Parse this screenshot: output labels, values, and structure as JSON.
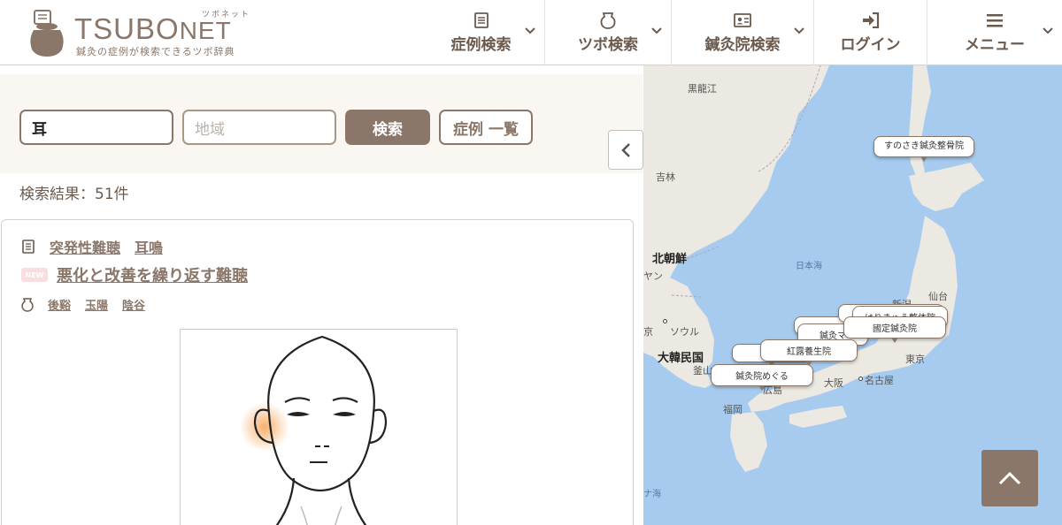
{
  "header": {
    "logo_main": "TSUBO",
    "logo_net": "NET",
    "logo_ruby": "ツボネット",
    "logo_subtitle": "鍼灸の症例が検索できるツボ辞典",
    "nav": [
      {
        "label": "症例検索",
        "icon": "document-icon",
        "has_dropdown": true
      },
      {
        "label": "ツボ検索",
        "icon": "jar-icon",
        "has_dropdown": true
      },
      {
        "label": "鍼灸院検索",
        "icon": "id-card-icon",
        "has_dropdown": true
      },
      {
        "label": "ログイン",
        "icon": "login-icon",
        "has_dropdown": false
      },
      {
        "label": "メニュー",
        "icon": "hamburger-icon",
        "has_dropdown": true
      }
    ]
  },
  "search": {
    "keyword_value": "耳",
    "region_placeholder": "地域",
    "search_button": "検索",
    "list_button": "症例 一覧"
  },
  "results": {
    "count_text": "検索結果：51件"
  },
  "case_card": {
    "symptoms": [
      "突発性難聴",
      "耳鳴"
    ],
    "badge": "NEW",
    "title": "悪化と改善を繰り返す難聴",
    "points": [
      "後谿",
      "玉陽",
      "陰谷"
    ]
  },
  "map": {
    "labels": {
      "heilongjiang": "黒龍江",
      "jilin": "吉林",
      "north_korea": "北朝鮮",
      "seoul": "ソウル",
      "south_korea": "大韓民国",
      "sea_of_japan": "日本海",
      "sendai": "仙台",
      "niigata": "新潟",
      "tokyo": "東京",
      "nagoya": "名古屋",
      "osaka": "大阪",
      "hiroshima": "広島",
      "fukuoka": "福岡",
      "busan": "釜山",
      "sea_small": "ナ海",
      "edge_kyo": "京",
      "edge_gyang": "ヤン"
    },
    "markers": [
      "すのさき鍼灸整骨院",
      "國定鍼灸院",
      "紅露養生院",
      "鍼灸院めぐる",
      "鍼灸マ",
      "はりきゅう整体院"
    ]
  },
  "colors": {
    "brand": "#8b7769",
    "search_bg": "#faf6f1",
    "sea": "#a7cbef",
    "land": "#ece9e2"
  }
}
